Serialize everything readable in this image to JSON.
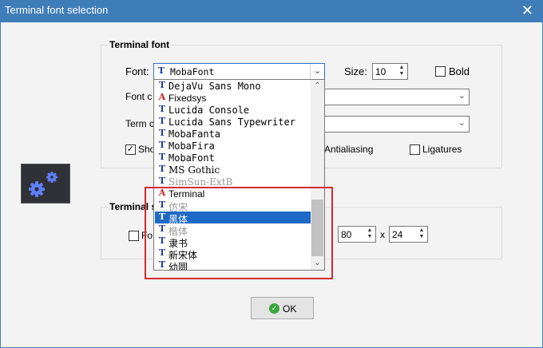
{
  "window": {
    "title": "Terminal font selection",
    "close_glyph": "✕"
  },
  "terminal_font": {
    "group_title": "Terminal font",
    "font_label": "Font:",
    "font_value": "MobaFont",
    "size_label": "Size:",
    "size_value": "10",
    "bold_label": "Bold",
    "font_color_label": "Font c",
    "term_color_label": "Term c",
    "show_label": "Sho",
    "antialiasing_label": "Antialiasing",
    "ligatures_label": "Ligatures"
  },
  "terminal_size": {
    "group_title": "Terminal s",
    "fixed_label": "Fo",
    "cols_value": "80",
    "x_separator": "x",
    "rows_value": "24"
  },
  "font_list": {
    "items": [
      {
        "name": "DejaVu Sans Mono",
        "icon": "truetype-icon"
      },
      {
        "name": "Fixedsys",
        "icon": "raster-font-icon"
      },
      {
        "name": "Lucida Console",
        "icon": "truetype-icon"
      },
      {
        "name": "Lucida Sans Typewriter",
        "icon": "truetype-icon"
      },
      {
        "name": "MobaFanta",
        "icon": "truetype-icon"
      },
      {
        "name": "MobaFira",
        "icon": "truetype-icon"
      },
      {
        "name": "MobaFont",
        "icon": "truetype-icon"
      },
      {
        "name": "MS Gothic",
        "icon": "truetype-icon"
      },
      {
        "name": "SimSun-ExtB",
        "icon": "truetype-icon"
      },
      {
        "name": "Terminal",
        "icon": "raster-font-icon"
      },
      {
        "name": "仿宋",
        "icon": "truetype-icon"
      },
      {
        "name": "黑体",
        "icon": "truetype-icon",
        "selected": true
      },
      {
        "name": "楷体",
        "icon": "truetype-icon"
      },
      {
        "name": "隶书",
        "icon": "truetype-icon"
      },
      {
        "name": "新宋体",
        "icon": "truetype-icon"
      },
      {
        "name": "幼圆",
        "icon": "truetype-icon"
      }
    ]
  },
  "buttons": {
    "ok_label": "OK"
  },
  "colors": {
    "titlebar": "#3f7db8",
    "selection": "#1f6ac6",
    "highlight_border": "#d42a2a"
  }
}
